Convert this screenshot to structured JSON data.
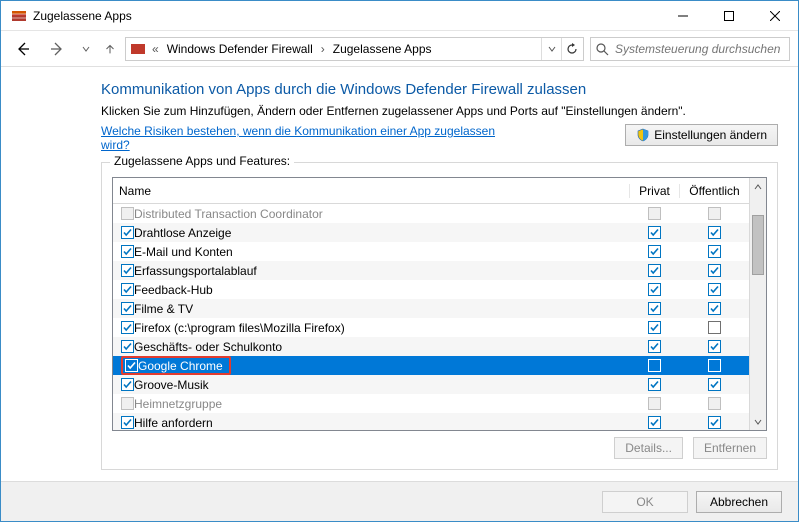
{
  "window": {
    "title": "Zugelassene Apps"
  },
  "nav": {
    "crumb1": "Windows Defender Firewall",
    "crumb2": "Zugelassene Apps",
    "search_placeholder": "Systemsteuerung durchsuchen"
  },
  "main": {
    "heading": "Kommunikation von Apps durch die Windows Defender Firewall zulassen",
    "subtext": "Klicken Sie zum Hinzufügen, Ändern oder Entfernen zugelassener Apps und Ports auf \"Einstellungen ändern\".",
    "risk_link": "Welche Risiken bestehen, wenn die Kommunikation einer App zugelassen wird?",
    "settings_button": "Einstellungen ändern"
  },
  "group": {
    "label": "Zugelassene Apps und Features:",
    "col_name": "Name",
    "col_private": "Privat",
    "col_public": "Öffentlich",
    "details_button": "Details...",
    "remove_button": "Entfernen"
  },
  "rows": [
    {
      "enabled": false,
      "label": "Distributed Transaction Coordinator",
      "priv": false,
      "pub": false,
      "disabled": true
    },
    {
      "enabled": true,
      "label": "Drahtlose Anzeige",
      "priv": true,
      "pub": true
    },
    {
      "enabled": true,
      "label": "E-Mail und Konten",
      "priv": true,
      "pub": true
    },
    {
      "enabled": true,
      "label": "Erfassungsportalablauf",
      "priv": true,
      "pub": true
    },
    {
      "enabled": true,
      "label": "Feedback-Hub",
      "priv": true,
      "pub": true
    },
    {
      "enabled": true,
      "label": "Filme & TV",
      "priv": true,
      "pub": true
    },
    {
      "enabled": true,
      "label": "Firefox (c:\\program files\\Mozilla Firefox)",
      "priv": true,
      "pub": false
    },
    {
      "enabled": true,
      "label": "Geschäfts- oder Schulkonto",
      "priv": true,
      "pub": true
    },
    {
      "enabled": true,
      "label": "Google Chrome",
      "priv": false,
      "pub": false,
      "selected": true,
      "highlight": true
    },
    {
      "enabled": true,
      "label": "Groove-Musik",
      "priv": true,
      "pub": true
    },
    {
      "enabled": false,
      "label": "Heimnetzgruppe",
      "priv": false,
      "pub": false,
      "disabled": true
    },
    {
      "enabled": true,
      "label": "Hilfe anfordern",
      "priv": true,
      "pub": true
    }
  ],
  "footer": {
    "ok": "OK",
    "cancel": "Abbrechen"
  }
}
